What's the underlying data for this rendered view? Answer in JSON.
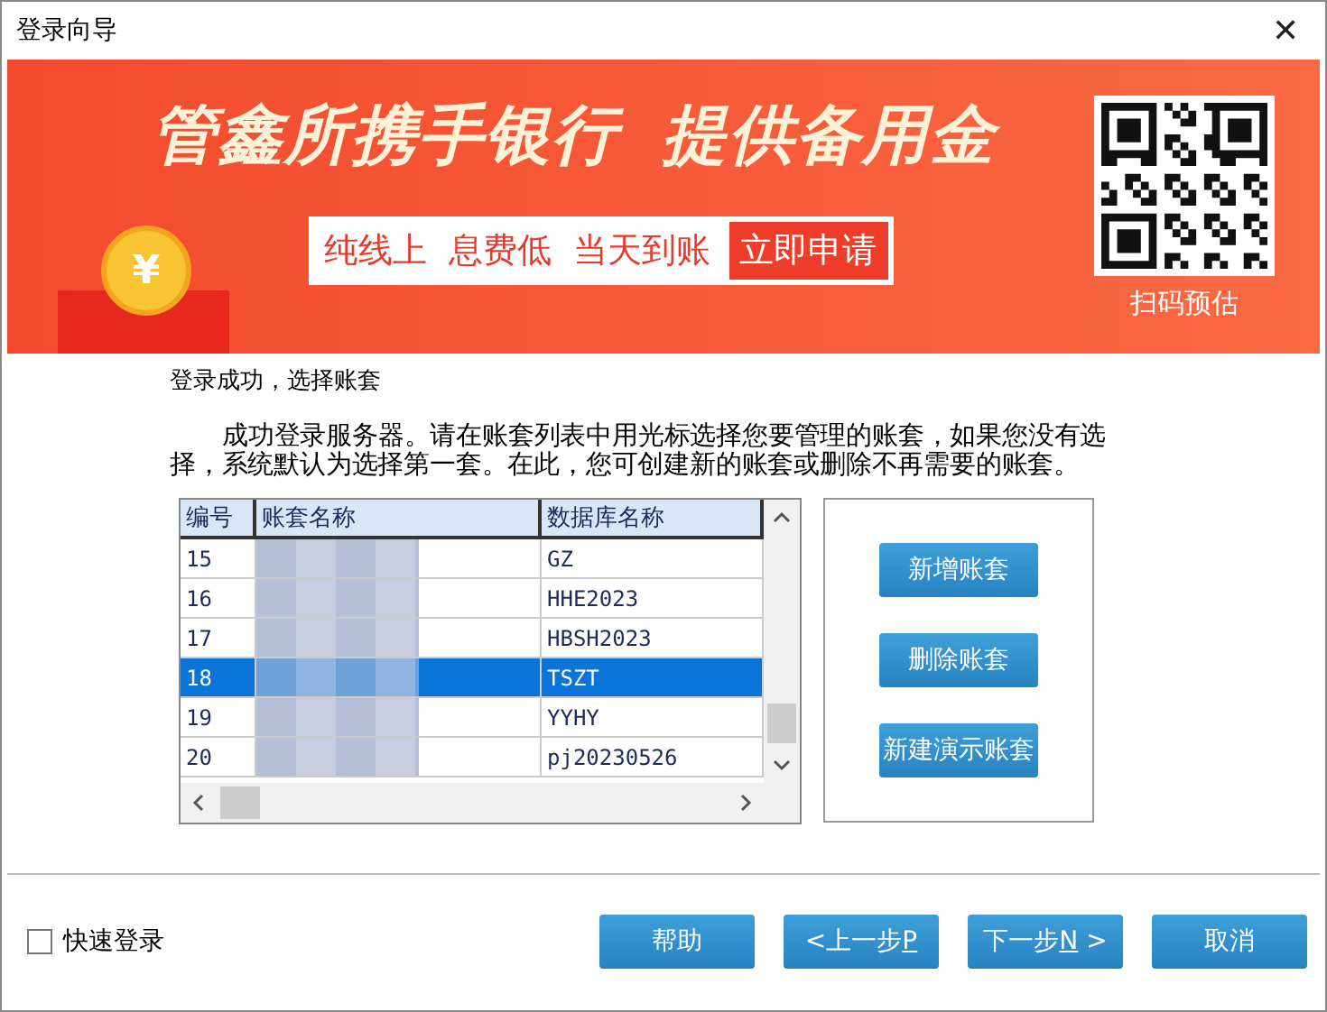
{
  "window": {
    "title": "登录向导",
    "close": "✕"
  },
  "banner": {
    "headline": [
      "管鑫所携手银行",
      "提供备用金"
    ],
    "coin": "¥",
    "slogans": [
      "纯线上",
      "息费低",
      "当天到账"
    ],
    "cta": "立即申请",
    "qr_caption": "扫码预估"
  },
  "heading": "登录成功，选择账套",
  "description": "成功登录服务器。请在账套列表中用光标选择您要管理的账套，如果您没有选择，系统默认为选择第一套。在此，您可创建新的账套或删除不再需要的账套。",
  "table": {
    "columns": [
      "编号",
      "账套名称",
      "数据库名称"
    ],
    "rows": [
      {
        "number": "15",
        "database": "GZ",
        "selected": false
      },
      {
        "number": "16",
        "database": "HHE2023",
        "selected": false
      },
      {
        "number": "17",
        "database": "HBSH2023",
        "selected": false
      },
      {
        "number": "18",
        "database": "TSZT",
        "selected": true
      },
      {
        "number": "19",
        "database": "YYHY",
        "selected": false
      },
      {
        "number": "20",
        "database": "pj20230526",
        "selected": false
      }
    ]
  },
  "side_buttons": [
    "新增账套",
    "删除账套",
    "新建演示账套"
  ],
  "quick_login": {
    "label": "快速登录",
    "checked": false
  },
  "footer_buttons": [
    {
      "label": "帮助"
    },
    {
      "prefix": "<",
      "label": "上一步",
      "key": "P"
    },
    {
      "label": "下一步",
      "key": "N",
      "suffix": " >"
    },
    {
      "label": "取消"
    }
  ]
}
